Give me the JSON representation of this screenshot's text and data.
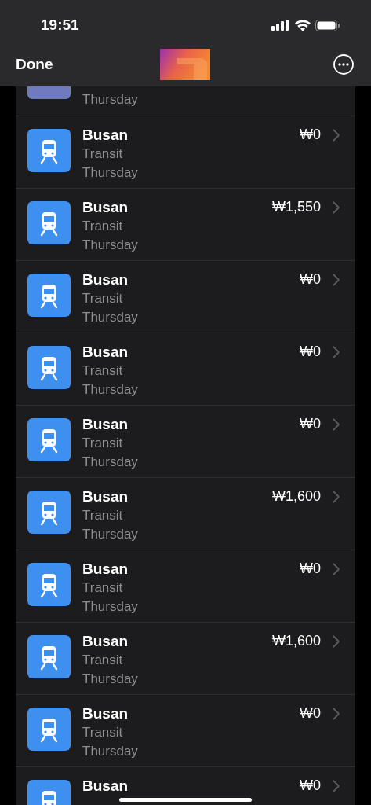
{
  "status_bar": {
    "time": "19:51"
  },
  "nav": {
    "done_label": "Done"
  },
  "partial_top_row": {
    "date": "Thursday"
  },
  "transactions": [
    {
      "place": "Busan",
      "category": "Transit",
      "date": "Thursday",
      "amount": "₩0"
    },
    {
      "place": "Busan",
      "category": "Transit",
      "date": "Thursday",
      "amount": "₩1,550"
    },
    {
      "place": "Busan",
      "category": "Transit",
      "date": "Thursday",
      "amount": "₩0"
    },
    {
      "place": "Busan",
      "category": "Transit",
      "date": "Thursday",
      "amount": "₩0"
    },
    {
      "place": "Busan",
      "category": "Transit",
      "date": "Thursday",
      "amount": "₩0"
    },
    {
      "place": "Busan",
      "category": "Transit",
      "date": "Thursday",
      "amount": "₩1,600"
    },
    {
      "place": "Busan",
      "category": "Transit",
      "date": "Thursday",
      "amount": "₩0"
    },
    {
      "place": "Busan",
      "category": "Transit",
      "date": "Thursday",
      "amount": "₩1,600"
    },
    {
      "place": "Busan",
      "category": "Transit",
      "date": "Thursday",
      "amount": "₩0"
    },
    {
      "place": "Busan",
      "amount": "₩0"
    }
  ]
}
